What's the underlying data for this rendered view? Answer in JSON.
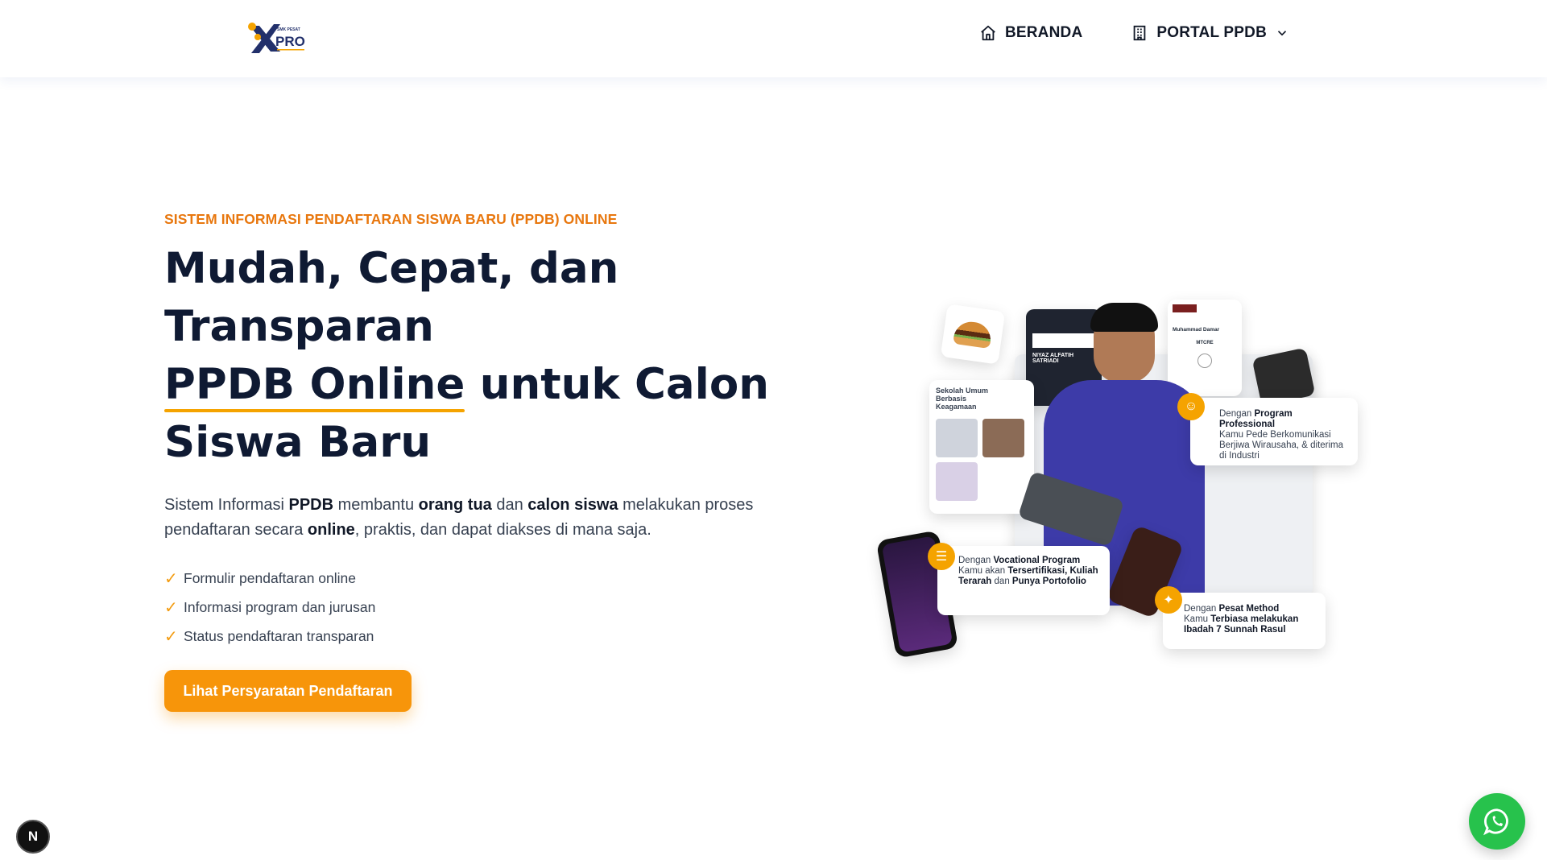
{
  "header": {
    "logo_small": "SMK PESAT",
    "logo_text": "PRO",
    "nav": {
      "home_label": "BERANDA",
      "portal_label": "PORTAL PPDB"
    }
  },
  "hero": {
    "eyebrow": "SISTEM INFORMASI PENDAFTARAN SISWA BARU (PPDB) ONLINE",
    "headline_line1": "Mudah, Cepat, dan Transparan",
    "headline_highlight": "PPDB Online",
    "headline_rest": " untuk Calon Siswa Baru",
    "desc": {
      "p1": "Sistem Informasi ",
      "b1": "PPDB",
      "p2": " membantu ",
      "b2": "orang tua",
      "p3": " dan ",
      "b3": "calon siswa",
      "p4": " melakukan proses pendaftaran secara ",
      "b4": "online",
      "p5": ", praktis, dan dapat diakses di mana saja."
    },
    "checklist": [
      "Formulir pendaftaran online",
      "Informasi program dan jurusan",
      "Status pendaftaran transparan"
    ],
    "cta_label": "Lihat Persyaratan Pendaftaran"
  },
  "illustration": {
    "card_sekolah": "Sekolah Umum Berbasis Keagamaan",
    "card_pro": {
      "pre": "Dengan ",
      "bold": "Program Professional",
      "rest": "Kamu Pede Berkomunikasi Berjiwa Wirausaha, & diterima di Industri"
    },
    "card_voc": {
      "pre": "Dengan ",
      "bold": "Vocational Program",
      "rest1": "Kamu akan ",
      "bold2": "Tersertifikasi, Kuliah Terarah",
      "rest2": " dan ",
      "bold3": "Punya Portofolio"
    },
    "card_pesat": {
      "pre": "Dengan ",
      "bold": "Pesat Method",
      "rest": "Kamu ",
      "bold2": "Terbiasa melakukan Ibadah 7 Sunnah Rasul"
    },
    "doc_name": "NIYAZ ALFATIH SATRIADI",
    "cert_name": "Muhammad Damar",
    "cert_sub": "MTCRE"
  },
  "floating": {
    "next_label": "N"
  },
  "colors": {
    "accent": "#f7950a",
    "eyebrow": "#e8770e",
    "heading": "#0f1a33",
    "whatsapp": "#27c24c"
  }
}
